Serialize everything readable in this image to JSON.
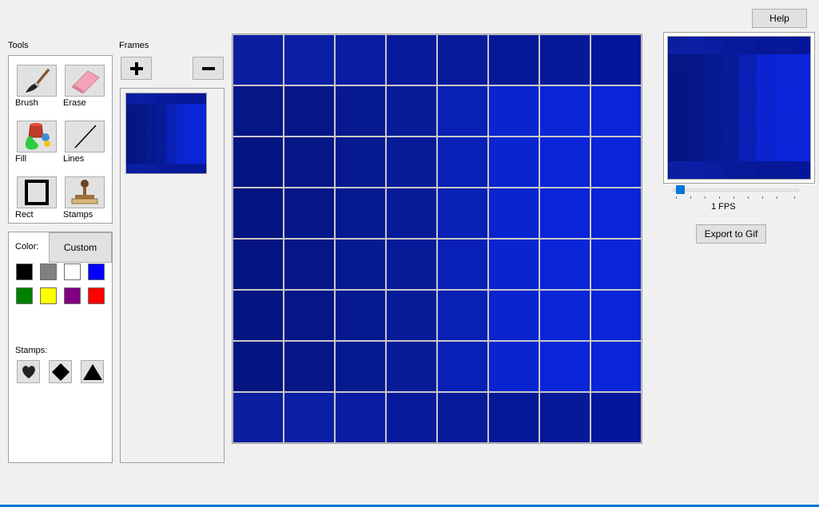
{
  "help_button": "Help",
  "tools": {
    "heading": "Tools",
    "items": [
      {
        "label": "Brush",
        "icon": "brush-icon"
      },
      {
        "label": "Erase",
        "icon": "eraser-icon"
      },
      {
        "label": "Fill",
        "icon": "paint-bucket-icon"
      },
      {
        "label": "Lines",
        "icon": "line-icon"
      },
      {
        "label": "Rect",
        "icon": "rectangle-icon"
      },
      {
        "label": "Stamps",
        "icon": "stamp-icon"
      }
    ]
  },
  "color_panel": {
    "label": "Color:",
    "custom_button": "Custom",
    "swatches": [
      "#000000",
      "#808080",
      "#ffffff",
      "#0000ff",
      "#008000",
      "#ffff00",
      "#800080",
      "#ff0000"
    ],
    "stamps_label": "Stamps:",
    "stamps": [
      "heart-icon",
      "diamond-icon",
      "triangle-icon"
    ]
  },
  "frames": {
    "heading": "Frames",
    "add_icon": "plus-icon",
    "remove_icon": "minus-icon",
    "count": 1
  },
  "canvas": {
    "rows": 8,
    "cols": 8,
    "cells": [
      [
        "#0a1ea0",
        "#0a1fa5",
        "#0a1ca0",
        "#081a9b",
        "#081a99",
        "#061897",
        "#071898",
        "#06169a"
      ],
      [
        "#051685",
        "#051788",
        "#06198f",
        "#071c99",
        "#0820b4",
        "#0a24d0",
        "#0a25d6",
        "#0a25d8"
      ],
      [
        "#041481",
        "#051687",
        "#06198f",
        "#071b98",
        "#0820b5",
        "#0a24d0",
        "#0a25d6",
        "#0a25d8"
      ],
      [
        "#041480",
        "#051686",
        "#061a90",
        "#071b99",
        "#0820b4",
        "#0a24d0",
        "#0a25d7",
        "#0a25d8"
      ],
      [
        "#041480",
        "#051687",
        "#061a8f",
        "#071b99",
        "#0820b5",
        "#0a24d0",
        "#0a25d6",
        "#0a25d8"
      ],
      [
        "#041481",
        "#051687",
        "#06198f",
        "#071c99",
        "#0820b4",
        "#0a24d0",
        "#0a25d6",
        "#0a25d8"
      ],
      [
        "#041480",
        "#051686",
        "#061a90",
        "#071b98",
        "#0820b5",
        "#0a24d0",
        "#0a25d7",
        "#0a25d8"
      ],
      [
        "#0a1ea0",
        "#0a1fa5",
        "#0a1ca0",
        "#081a9b",
        "#081a99",
        "#061897",
        "#071898",
        "#06169a"
      ]
    ]
  },
  "preview": {
    "fps_label": "1 FPS",
    "fps_value": 1,
    "export_button": "Export to Gif"
  }
}
